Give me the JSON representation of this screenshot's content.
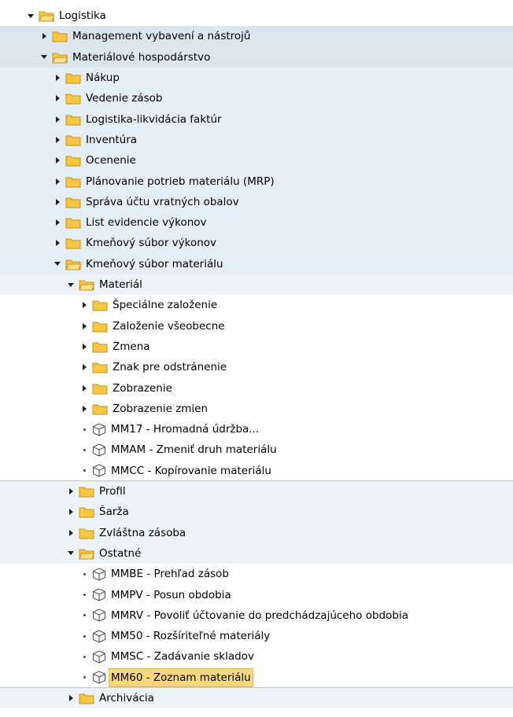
{
  "tree": [
    {
      "label": "Logistika",
      "level": 0,
      "kind": "folder",
      "state": "expanded"
    },
    {
      "label": "Management vybavení a nástrojů",
      "level": 1,
      "kind": "folder",
      "state": "collapsed"
    },
    {
      "label": "Materiálové hospodárstvo",
      "level": 1,
      "kind": "folder",
      "state": "expanded"
    },
    {
      "label": "Nákup",
      "level": 2,
      "kind": "folder",
      "state": "collapsed"
    },
    {
      "label": "Vedenie zásob",
      "level": 2,
      "kind": "folder",
      "state": "collapsed"
    },
    {
      "label": "Logistika-likvidácia faktúr",
      "level": 2,
      "kind": "folder",
      "state": "collapsed"
    },
    {
      "label": "Inventúra",
      "level": 2,
      "kind": "folder",
      "state": "collapsed"
    },
    {
      "label": "Ocenenie",
      "level": 2,
      "kind": "folder",
      "state": "collapsed"
    },
    {
      "label": "Plánovanie potrieb materiálu (MRP)",
      "level": 2,
      "kind": "folder",
      "state": "collapsed"
    },
    {
      "label": "Správa účtu vratných obalov",
      "level": 2,
      "kind": "folder",
      "state": "collapsed"
    },
    {
      "label": "List evidencie výkonov",
      "level": 2,
      "kind": "folder",
      "state": "collapsed"
    },
    {
      "label": "Kmeňový súbor výkonov",
      "level": 2,
      "kind": "folder",
      "state": "collapsed"
    },
    {
      "label": "Kmeňový súbor materiálu",
      "level": 2,
      "kind": "folder",
      "state": "expanded"
    },
    {
      "label": "Materiál",
      "level": 3,
      "kind": "folder",
      "state": "expanded"
    },
    {
      "label": "Špeciálne založenie",
      "level": 4,
      "kind": "folder",
      "state": "collapsed"
    },
    {
      "label": "Založenie všeobecne",
      "level": 4,
      "kind": "folder",
      "state": "collapsed"
    },
    {
      "label": "Zmena",
      "level": 4,
      "kind": "folder",
      "state": "collapsed"
    },
    {
      "label": "Znak pre odstránenie",
      "level": 4,
      "kind": "folder",
      "state": "collapsed"
    },
    {
      "label": "Zobrazenie",
      "level": 4,
      "kind": "folder",
      "state": "collapsed"
    },
    {
      "label": "Zobrazenie zmien",
      "level": 4,
      "kind": "folder",
      "state": "collapsed"
    },
    {
      "label": "MM17 - Hromadná údržba...",
      "level": 4,
      "kind": "transaction"
    },
    {
      "label": "MMAM - Zmeniť druh materiálu",
      "level": 4,
      "kind": "transaction"
    },
    {
      "label": "MMCC - Kopírovanie materiálu",
      "level": 4,
      "kind": "transaction"
    },
    {
      "label": "Profil",
      "level": 3,
      "kind": "folder",
      "state": "collapsed"
    },
    {
      "label": "Šarža",
      "level": 3,
      "kind": "folder",
      "state": "collapsed"
    },
    {
      "label": "Zvláštna zásoba",
      "level": 3,
      "kind": "folder",
      "state": "collapsed"
    },
    {
      "label": "Ostatné",
      "level": 3,
      "kind": "folder",
      "state": "expanded"
    },
    {
      "label": "MMBE - Prehľad zásob",
      "level": 4,
      "kind": "transaction"
    },
    {
      "label": "MMPV - Posun obdobia",
      "level": 4,
      "kind": "transaction"
    },
    {
      "label": "MMRV - Povoliť účtovanie do predchádzajúceho obdobia",
      "level": 4,
      "kind": "transaction"
    },
    {
      "label": "MM50 - Rozšíriteľné materiály",
      "level": 4,
      "kind": "transaction"
    },
    {
      "label": "MMSC - Zadávanie skladov",
      "level": 4,
      "kind": "transaction"
    },
    {
      "label": "MM60 - Zoznam materiálu",
      "level": 4,
      "kind": "transaction",
      "selected": true
    },
    {
      "label": "Archivácia",
      "level": 3,
      "kind": "folder",
      "state": "collapsed"
    }
  ],
  "colors": {
    "folder_fill": "#f7c744",
    "folder_edge": "#c8901b",
    "band_level1": "#dce6ef",
    "band_level2": "#e6eef5",
    "band_level3": "#eef3f8",
    "selection": "#f8d87a"
  },
  "icons": {
    "folder_closed": "folder-icon",
    "folder_open": "folder-open-icon",
    "transaction": "cube-icon",
    "expand": "triangle-right-icon",
    "collapse": "triangle-down-icon",
    "leaf": "bullet-icon"
  }
}
